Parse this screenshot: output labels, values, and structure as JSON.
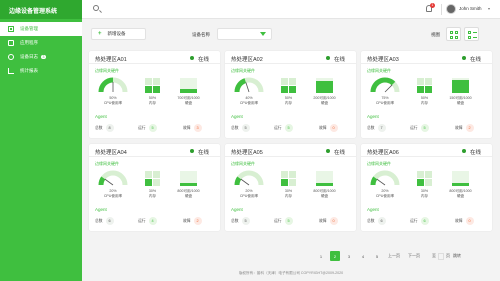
{
  "app": {
    "title": "边缘设备管理系统"
  },
  "sidebar": {
    "items": [
      {
        "label": "设备管理",
        "icon": "grid-icon",
        "active": true
      },
      {
        "label": "应用程序",
        "icon": "doc-icon",
        "active": false
      },
      {
        "label": "设备日志",
        "icon": "gear-icon",
        "active": false,
        "badge": "3"
      },
      {
        "label": "统计报表",
        "icon": "chart-icon",
        "active": false
      }
    ]
  },
  "topbar": {
    "notification_count": "1",
    "user_name": "John Smith"
  },
  "toolbar": {
    "add_label": "新增设备",
    "filter_label": "设备名称",
    "filter_value": "",
    "view_label": "视图"
  },
  "cards": [
    {
      "title": "热处理区A01",
      "status": "在线",
      "hw_label": "边缘网关硬件",
      "cpu_pct": "50%",
      "cpu_label": "CPU使用率",
      "cpu_value": 50,
      "mem_pct": "50%",
      "mem_label": "内存",
      "mem_level": 2,
      "disk_value": "700可用/1000",
      "disk_label": "硬盘",
      "disk_fill": 0.3,
      "agent_label": "Agent",
      "total_label": "总数",
      "total": "8",
      "running_label": "运行",
      "running": "5",
      "fault_label": "故障",
      "fault": "3"
    },
    {
      "title": "热处理区A02",
      "status": "在线",
      "hw_label": "边缘网关硬件",
      "cpu_pct": "40%",
      "cpu_label": "CPU使用率",
      "cpu_value": 40,
      "mem_pct": "50%",
      "mem_label": "内存",
      "mem_level": 2,
      "disk_value": "200可用/1000",
      "disk_label": "硬盘",
      "disk_fill": 0.8,
      "agent_label": "Agent",
      "total_label": "总数",
      "total": "5",
      "running_label": "运行",
      "running": "5",
      "fault_label": "故障",
      "fault": "0"
    },
    {
      "title": "热处理区A03",
      "status": "在线",
      "hw_label": "边缘网关硬件",
      "cpu_pct": "75%",
      "cpu_label": "CPU使用率",
      "cpu_value": 75,
      "mem_pct": "50%",
      "mem_label": "内存",
      "mem_level": 2,
      "disk_value": "150可用/1000",
      "disk_label": "硬盘",
      "disk_fill": 0.85,
      "agent_label": "Agent",
      "total_label": "总数",
      "total": "7",
      "running_label": "运行",
      "running": "5",
      "fault_label": "故障",
      "fault": "2"
    },
    {
      "title": "热处理区A04",
      "status": "在线",
      "hw_label": "边缘网关硬件",
      "cpu_pct": "20%",
      "cpu_label": "CPU使用率",
      "cpu_value": 20,
      "mem_pct": "30%",
      "mem_label": "内存",
      "mem_level": 1,
      "disk_value": "800可用/1000",
      "disk_label": "硬盘",
      "disk_fill": 0.2,
      "agent_label": "Agent",
      "total_label": "总数",
      "total": "6",
      "running_label": "运行",
      "running": "4",
      "fault_label": "故障",
      "fault": "2"
    },
    {
      "title": "热处理区A05",
      "status": "在线",
      "hw_label": "边缘网关硬件",
      "cpu_pct": "20%",
      "cpu_label": "CPU使用率",
      "cpu_value": 20,
      "mem_pct": "30%",
      "mem_label": "内存",
      "mem_level": 1,
      "disk_value": "800可用/1000",
      "disk_label": "硬盘",
      "disk_fill": 0.2,
      "agent_label": "Agent",
      "total_label": "总数",
      "total": "5",
      "running_label": "运行",
      "running": "5",
      "fault_label": "故障",
      "fault": "0"
    },
    {
      "title": "热处理区A06",
      "status": "在线",
      "hw_label": "边缘网关硬件",
      "cpu_pct": "20%",
      "cpu_label": "CPU使用率",
      "cpu_value": 20,
      "mem_pct": "30%",
      "mem_label": "内存",
      "mem_level": 1,
      "disk_value": "800可用/1000",
      "disk_label": "硬盘",
      "disk_fill": 0.2,
      "agent_label": "Agent",
      "total_label": "总数",
      "total": "6",
      "running_label": "运行",
      "running": "6",
      "fault_label": "故障",
      "fault": "0"
    }
  ],
  "pagination": {
    "pages": [
      "1",
      "2",
      "3",
      "4",
      "5"
    ],
    "current": "2",
    "prev_label": "上一页",
    "next_label": "下一页",
    "jump_prefix": "至",
    "jump_suffix": "页",
    "jump_go": "跳转"
  },
  "footer": {
    "text": "版权所有：普科（天津）电子有限公司 COPYRIGHT@2009-2020"
  },
  "colors": {
    "brand": "#3fbf3f",
    "brand_dark": "#2fa82f",
    "online": "#2e9e2e",
    "fault": "#f06c3b"
  }
}
